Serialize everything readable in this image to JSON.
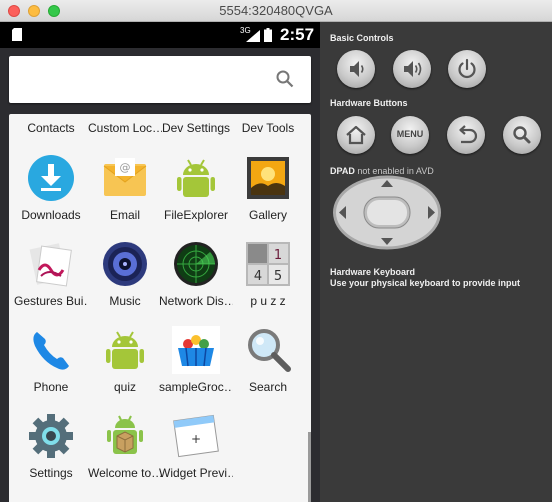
{
  "window": {
    "title": "5554:320480QVGA"
  },
  "statusbar": {
    "network": "3G",
    "time": "2:57"
  },
  "drawer": {
    "top_row": [
      "Contacts",
      "Custom Loc…",
      "Dev Settings",
      "Dev Tools"
    ],
    "apps": [
      {
        "label": "Downloads",
        "icon": "download-icon"
      },
      {
        "label": "Email",
        "icon": "email-icon"
      },
      {
        "label": "FileExplorer",
        "icon": "android-icon"
      },
      {
        "label": "Gallery",
        "icon": "gallery-icon"
      },
      {
        "label": "Gestures Bui…",
        "icon": "gestures-icon"
      },
      {
        "label": "Music",
        "icon": "music-icon"
      },
      {
        "label": "Network Dis…",
        "icon": "radar-icon"
      },
      {
        "label": "p u z z",
        "icon": "puzzle-icon"
      },
      {
        "label": "Phone",
        "icon": "phone-icon"
      },
      {
        "label": "quiz",
        "icon": "android-icon"
      },
      {
        "label": "sampleGroc…",
        "icon": "basket-icon"
      },
      {
        "label": "Search",
        "icon": "magnifier-icon"
      },
      {
        "label": "Settings",
        "icon": "gear-icon"
      },
      {
        "label": "Welcome to…",
        "icon": "android-box-icon"
      },
      {
        "label": "Widget Previ…",
        "icon": "widget-preview-icon"
      }
    ]
  },
  "panel": {
    "basic_controls": "Basic Controls",
    "hardware_buttons": "Hardware Buttons",
    "menu_label": "MENU",
    "dpad_bold": "DPAD",
    "dpad_note": "not enabled in AVD",
    "keyboard_title": "Hardware Keyboard",
    "keyboard_note": "Use your physical keyboard to provide input"
  },
  "colors": {
    "accent_blue": "#29a8e0",
    "android_green": "#a4c639",
    "drawer_bg": "#f5f5f5",
    "panel_bg": "#3a3a3a"
  }
}
